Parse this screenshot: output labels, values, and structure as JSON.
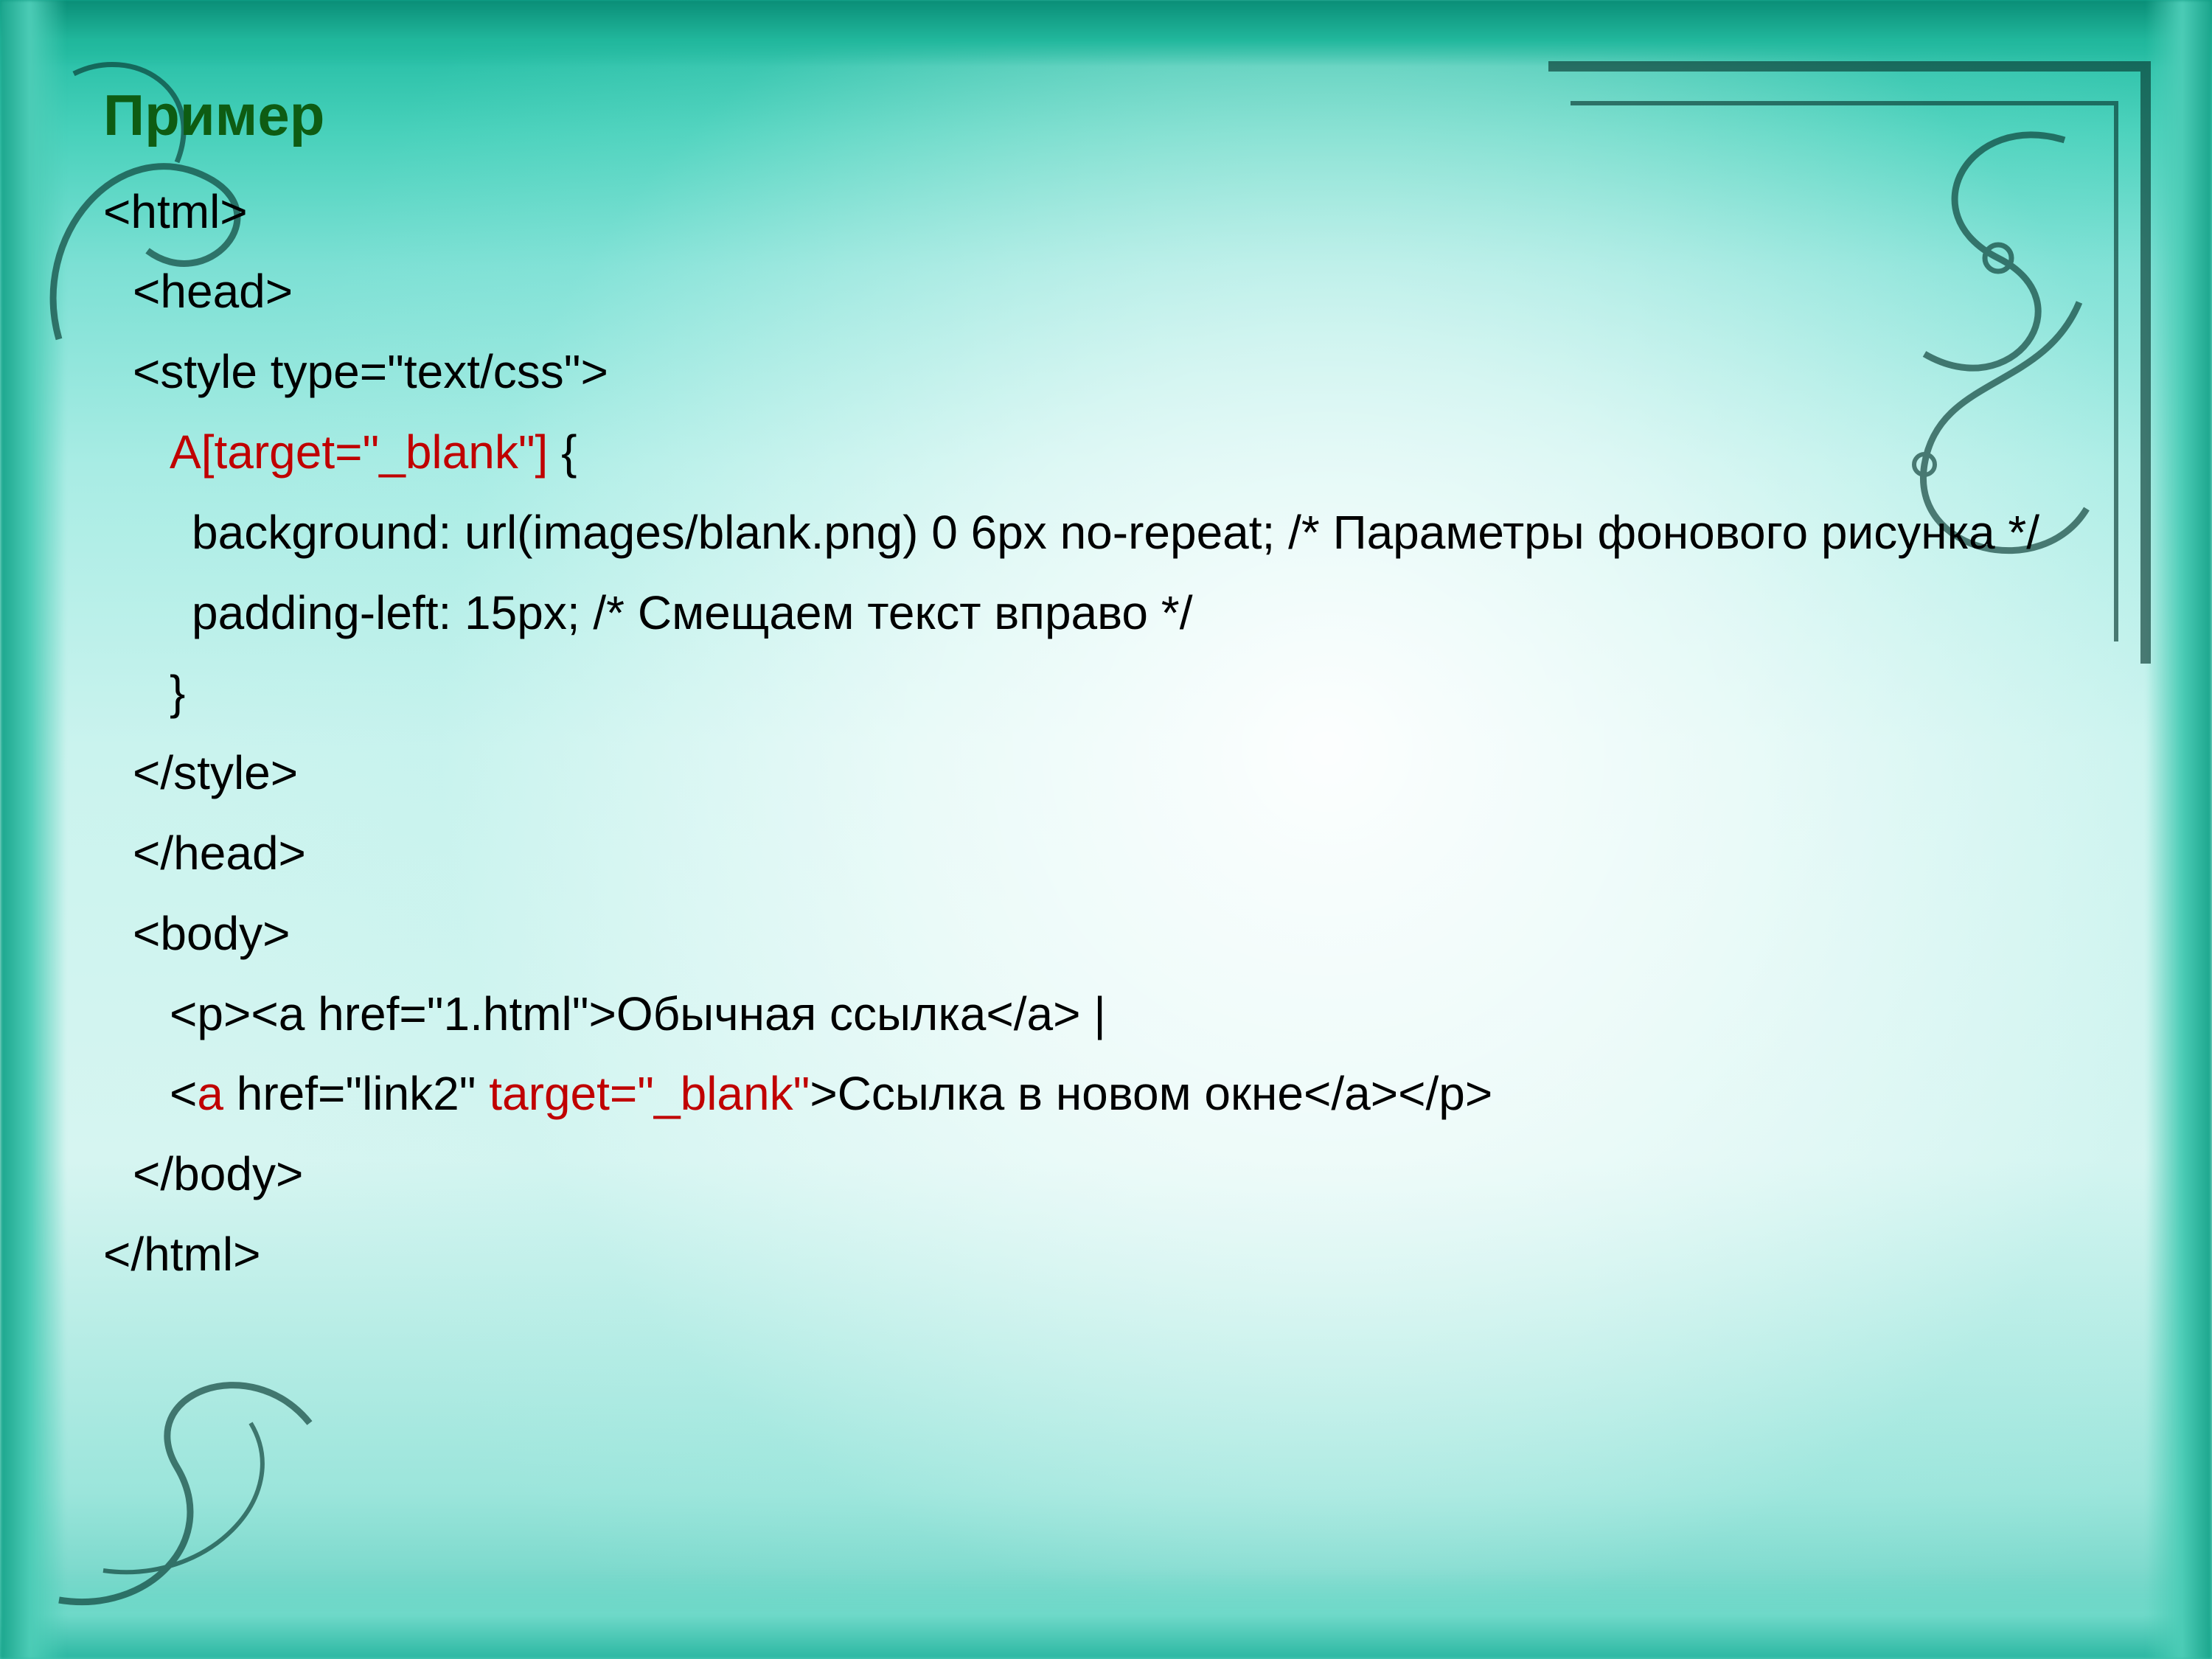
{
  "title": "Пример",
  "code": {
    "l1": "<html>",
    "l2": "<head>",
    "l3": "<style type=\"text/css\">",
    "l4_selector": "A[target=\"_blank\"]",
    "l4_brace": " {",
    "l5": "background: url(images/blank.png) 0 6px no-repeat; /* Параметры фонового рисунка */",
    "l6": "padding-left: 15px; /* Смещаем текст вправо */",
    "l7": "}",
    "l8": "</style>",
    "l9": "</head>",
    "l10": "<body>",
    "l11": "<p><a href=\"1.html\">Обычная ссылка</a> |",
    "l12_a_open_pre": "<",
    "l12_a_open_name": "a",
    "l12_a_open_mid": " href=\"link2\" ",
    "l12_a_attr": "target=\"_blank\"",
    "l12_rest": ">Ссылка в новом окне</a></p>",
    "l13": "</body>",
    "l14": "</html>"
  }
}
